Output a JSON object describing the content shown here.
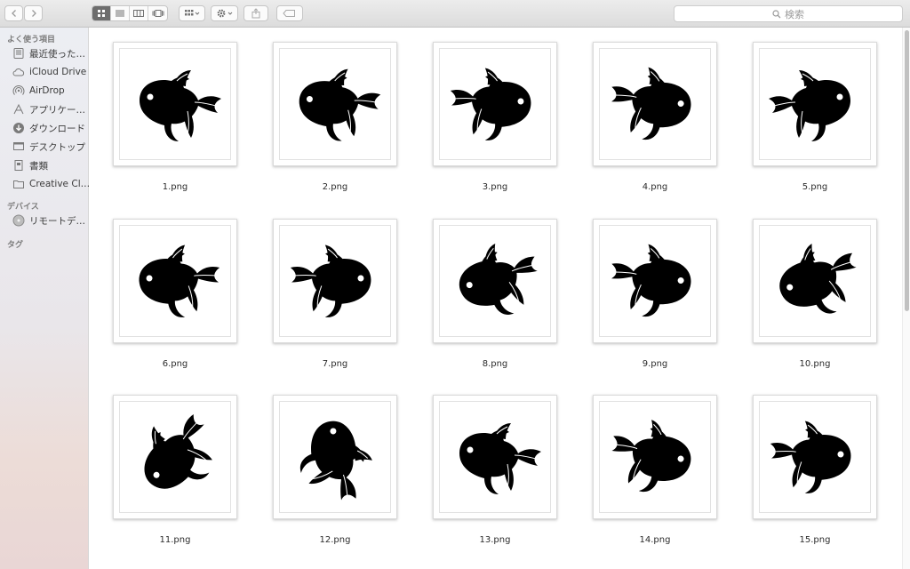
{
  "toolbar": {
    "back_icon": "chevron-left-icon",
    "forward_icon": "chevron-right-icon",
    "view_modes": [
      "icon-view",
      "list-view",
      "column-view",
      "cover-flow-view"
    ],
    "arrange_icon": "arrange-grid-icon",
    "action_icon": "gear-icon",
    "share_icon": "share-icon",
    "tag_icon": "tag-icon",
    "search_placeholder": "検索"
  },
  "sidebar": {
    "favorites_header": "よく使う項目",
    "favorites": [
      {
        "label": "最近使った…",
        "icon": "recents-icon"
      },
      {
        "label": "iCloud Drive",
        "icon": "cloud-icon"
      },
      {
        "label": "AirDrop",
        "icon": "airdrop-icon"
      },
      {
        "label": "アプリケー…",
        "icon": "applications-icon"
      },
      {
        "label": "ダウンロード",
        "icon": "download-icon"
      },
      {
        "label": "デスクトップ",
        "icon": "desktop-icon"
      },
      {
        "label": "書類",
        "icon": "documents-icon"
      },
      {
        "label": "Creative Cl…",
        "icon": "folder-icon"
      }
    ],
    "devices_header": "デバイス",
    "devices": [
      {
        "label": "リモートデ…",
        "icon": "remote-disc-icon"
      }
    ],
    "tags_header": "タグ"
  },
  "files": [
    {
      "name": "1.png"
    },
    {
      "name": "2.png"
    },
    {
      "name": "3.png"
    },
    {
      "name": "4.png"
    },
    {
      "name": "5.png"
    },
    {
      "name": "6.png"
    },
    {
      "name": "7.png"
    },
    {
      "name": "8.png"
    },
    {
      "name": "9.png"
    },
    {
      "name": "10.png"
    },
    {
      "name": "11.png"
    },
    {
      "name": "12.png"
    },
    {
      "name": "13.png"
    },
    {
      "name": "14.png"
    },
    {
      "name": "15.png"
    }
  ]
}
